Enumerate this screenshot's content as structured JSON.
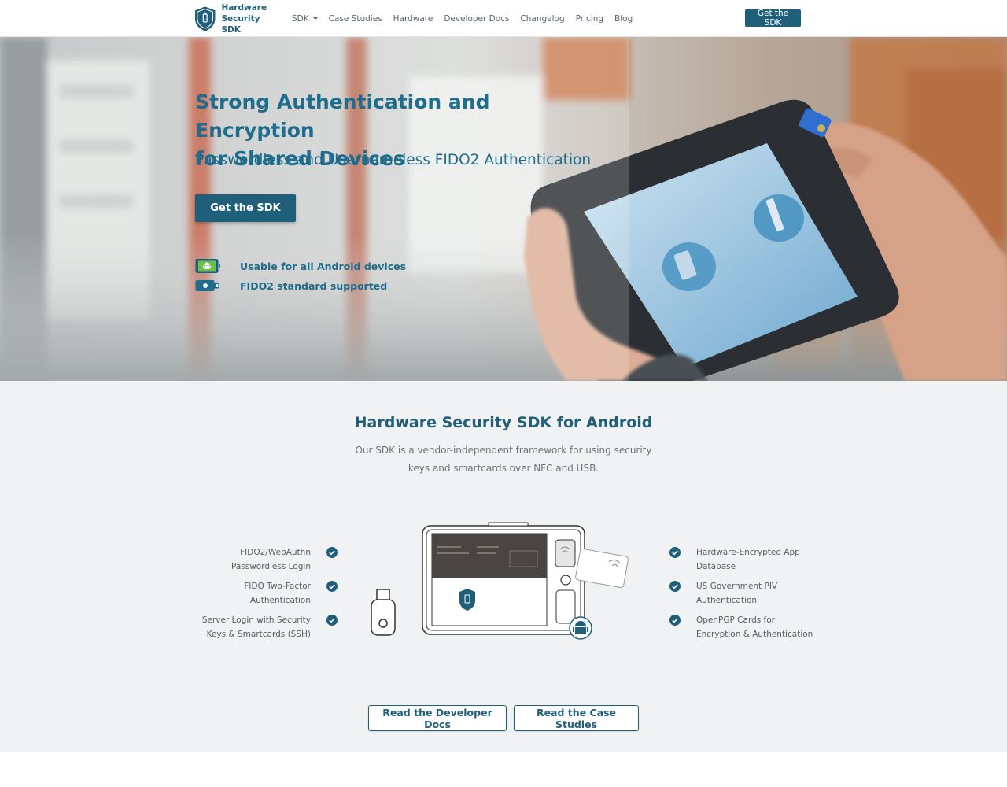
{
  "brand": {
    "line1": "Hardware",
    "line2": "Security SDK"
  },
  "nav": {
    "items": [
      {
        "label": "SDK",
        "has_dropdown": true
      },
      {
        "label": "Case Studies"
      },
      {
        "label": "Hardware"
      },
      {
        "label": "Developer Docs"
      },
      {
        "label": "Changelog"
      },
      {
        "label": "Pricing"
      },
      {
        "label": "Blog"
      }
    ],
    "cta": "Get the SDK"
  },
  "hero": {
    "title_line1": "Strong Authentication and Encryption",
    "title_line2": "for Shared Devices",
    "subtitle": "Passwordless and Usernameless FIDO2 Authentication",
    "cta": "Get the SDK",
    "features": [
      {
        "icon": "android-device-icon",
        "label": "Usable for all Android devices"
      },
      {
        "icon": "security-key-icon",
        "label": "FIDO2 standard supported"
      }
    ]
  },
  "section": {
    "title": "Hardware Security SDK for Android",
    "description_line1": "Our SDK is a vendor-independent framework for using security",
    "description_line2": "keys and smartcards over NFC and USB.",
    "left_features": [
      {
        "line1": "FIDO2/WebAuthn",
        "line2": "Passwordless Login"
      },
      {
        "line1": "FIDO Two-Factor",
        "line2": "Authentication"
      },
      {
        "line1": "Server Login with Security",
        "line2": "Keys & Smartcards (SSH)"
      }
    ],
    "right_features": [
      {
        "line1": "Hardware-Encrypted App",
        "line2": "Database"
      },
      {
        "line1": "US Government PIV",
        "line2": "Authentication"
      },
      {
        "line1": "OpenPGP Cards for",
        "line2": "Encryption & Authentication"
      }
    ],
    "buttons": {
      "docs": "Read the Developer Docs",
      "case_studies": "Read the Case Studies"
    }
  },
  "colors": {
    "brand": "#1f5f7a",
    "accent": "#1f6c8c",
    "section_bg": "#f1f2f3"
  }
}
